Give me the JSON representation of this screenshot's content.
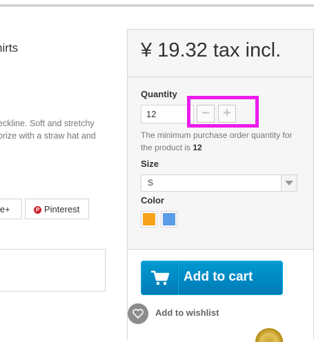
{
  "product": {
    "title_partial": "hirts",
    "description_lines": [
      "eckline. Soft and stretchy",
      "orize with a straw hat and"
    ]
  },
  "share": {
    "google_partial": "le+",
    "pinterest_label": "Pinterest"
  },
  "price": {
    "text": "¥ 19.32 tax incl."
  },
  "quantity": {
    "label": "Quantity",
    "value": "12",
    "minus": "−",
    "plus": "+",
    "minimum_text": "The minimum purchase order quantity for the product is ",
    "minimum_value": "12"
  },
  "size": {
    "label": "Size",
    "selected": "S"
  },
  "color": {
    "label": "Color",
    "options": [
      "#f7a21b",
      "#5b9ce8"
    ]
  },
  "cart": {
    "add_label": "Add to cart",
    "wishlist_label": "Add to wishlist"
  },
  "icons": [
    "pinterest-icon",
    "cart-icon",
    "heart-icon",
    "select-arrow-icon"
  ],
  "highlight_color": "#ec1ded",
  "accent_color": "#009ad0"
}
